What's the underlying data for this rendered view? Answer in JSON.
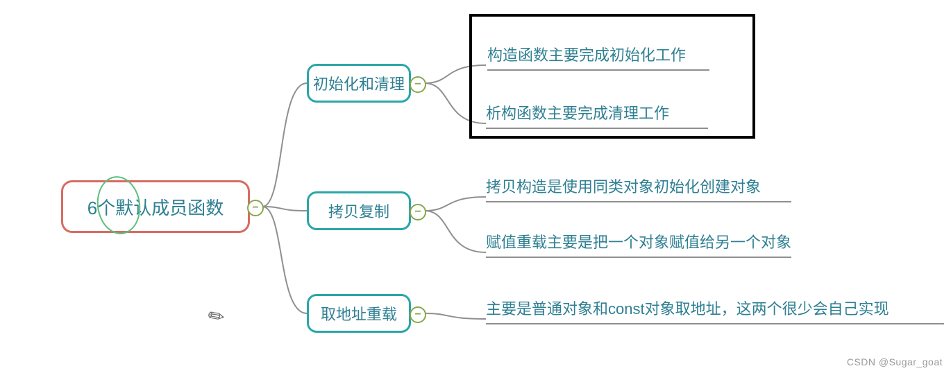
{
  "root": {
    "label": "6个默认成员函数"
  },
  "children": [
    {
      "label": "初始化和清理",
      "leaves": [
        "构造函数主要完成初始化工作",
        "析构函数主要完成清理工作"
      ]
    },
    {
      "label": "拷贝复制",
      "leaves": [
        "拷贝构造是使用同类对象初始化创建对象",
        "赋值重载主要是把一个对象赋值给另一个对象"
      ]
    },
    {
      "label": "取地址重载",
      "leaves": [
        "主要是普通对象和const对象取地址，这两个很少会自己实现"
      ]
    }
  ],
  "watermark": "CSDN @Sugar_goat",
  "colors": {
    "root_border": "#d86b62",
    "child_border": "#2aa6a6",
    "text": "#2e7f92",
    "toggle": "#86a74a",
    "highlight_box": "#000000"
  }
}
